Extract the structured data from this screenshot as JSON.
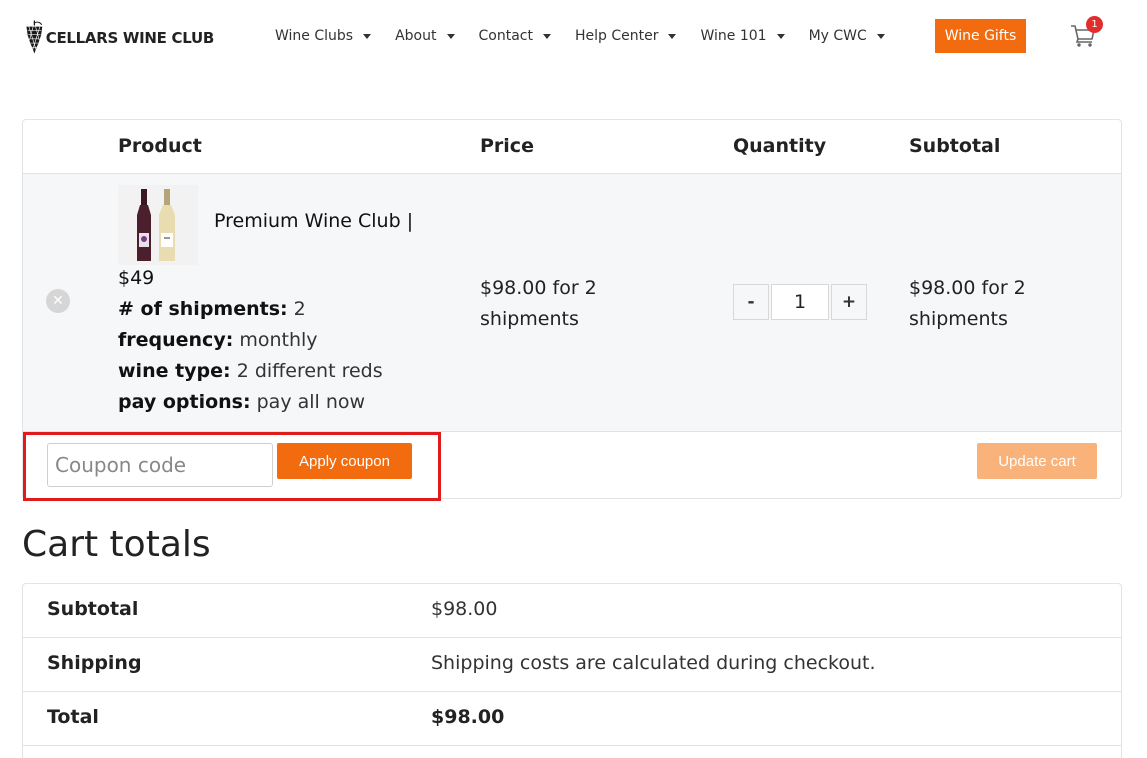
{
  "header": {
    "logo_text": "CELLARS WINE CLUB",
    "nav": [
      "Wine Clubs",
      "About",
      "Contact",
      "Help Center",
      "Wine 101",
      "My CWC"
    ],
    "gifts_label": "Wine Gifts",
    "cart_count": "1"
  },
  "cart": {
    "headers": {
      "product": "Product",
      "price": "Price",
      "quantity": "Quantity",
      "subtotal": "Subtotal"
    },
    "item": {
      "name": "Premium Wine Club |",
      "price_line": "$49",
      "meta": [
        {
          "label": "# of shipments:",
          "value": "2"
        },
        {
          "label": "frequency:",
          "value": "monthly"
        },
        {
          "label": "wine type:",
          "value": "2 different reds"
        },
        {
          "label": "pay options:",
          "value": "pay all now"
        }
      ],
      "price": "$98.00 for 2 shipments",
      "quantity": "1",
      "qty_minus": "-",
      "qty_plus": "+",
      "subtotal": "$98.00 for 2 shipments"
    },
    "coupon_placeholder": "Coupon code",
    "apply_label": "Apply coupon",
    "update_label": "Update cart"
  },
  "totals": {
    "title": "Cart totals",
    "rows": [
      {
        "label": "Subtotal",
        "value": "$98.00"
      },
      {
        "label": "Shipping",
        "value": "Shipping costs are calculated during checkout."
      },
      {
        "label": "Total",
        "value": "$98.00"
      }
    ]
  },
  "colors": {
    "accent": "#f26b0f",
    "accent_disabled": "#f8b27a",
    "highlight": "#e01b1b",
    "badge": "#e22d2d"
  }
}
